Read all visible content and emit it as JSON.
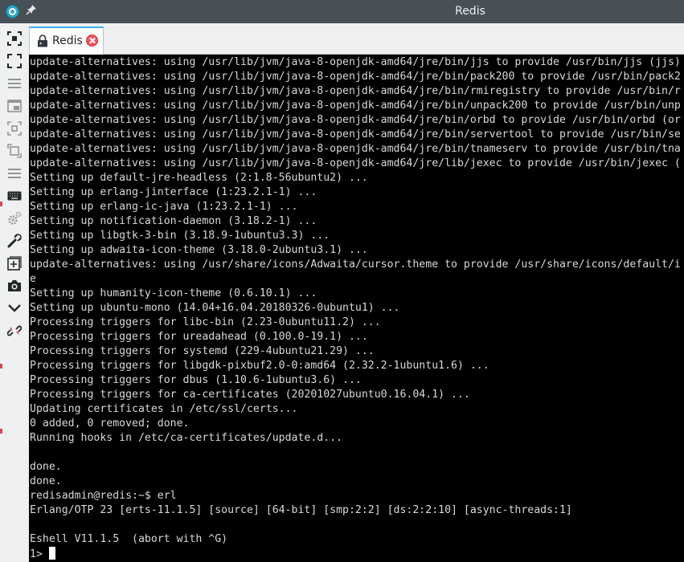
{
  "window": {
    "title": "Redis"
  },
  "titlebar": {
    "app_icon": "app-icon",
    "pin_icon": "pin-icon"
  },
  "toolbar": {
    "items": [
      {
        "name": "screenshot-select-icon",
        "enabled": true
      },
      {
        "name": "fullscreen-icon",
        "enabled": true
      },
      {
        "name": "menu-lines-icon",
        "enabled": false
      },
      {
        "name": "window-icon",
        "enabled": false
      },
      {
        "name": "fit-screen-icon",
        "enabled": false
      },
      {
        "name": "resize-icon",
        "enabled": false
      },
      {
        "name": "list-icon",
        "enabled": false
      },
      {
        "name": "keyboard-icon",
        "enabled": true
      },
      {
        "name": "settings-icon",
        "enabled": false
      },
      {
        "name": "wrench-icon",
        "enabled": true
      },
      {
        "name": "new-window-icon",
        "enabled": true
      },
      {
        "name": "camera-icon",
        "enabled": true
      },
      {
        "name": "chevron-down-icon",
        "enabled": true
      },
      {
        "name": "disconnect-icon",
        "enabled": true
      }
    ]
  },
  "tabs": [
    {
      "label": "Redis",
      "icon": "terminal-lock-icon",
      "close_icon": "close-icon",
      "active": true
    }
  ],
  "terminal": {
    "lines": [
      "update-alternatives: using /usr/lib/jvm/java-8-openjdk-amd64/jre/bin/jjs to provide /usr/bin/jjs (jjs)",
      "update-alternatives: using /usr/lib/jvm/java-8-openjdk-amd64/jre/bin/pack200 to provide /usr/bin/pack2",
      "update-alternatives: using /usr/lib/jvm/java-8-openjdk-amd64/jre/bin/rmiregistry to provide /usr/bin/r",
      "update-alternatives: using /usr/lib/jvm/java-8-openjdk-amd64/jre/bin/unpack200 to provide /usr/bin/unp",
      "update-alternatives: using /usr/lib/jvm/java-8-openjdk-amd64/jre/bin/orbd to provide /usr/bin/orbd (or",
      "update-alternatives: using /usr/lib/jvm/java-8-openjdk-amd64/jre/bin/servertool to provide /usr/bin/se",
      "update-alternatives: using /usr/lib/jvm/java-8-openjdk-amd64/jre/bin/tnameserv to provide /usr/bin/tna",
      "update-alternatives: using /usr/lib/jvm/java-8-openjdk-amd64/jre/lib/jexec to provide /usr/bin/jexec (",
      "Setting up default-jre-headless (2:1.8-56ubuntu2) ...",
      "Setting up erlang-jinterface (1:23.2.1-1) ...",
      "Setting up erlang-ic-java (1:23.2.1-1) ...",
      "Setting up notification-daemon (3.18.2-1) ...",
      "Setting up libgtk-3-bin (3.18.9-1ubuntu3.3) ...",
      "Setting up adwaita-icon-theme (3.18.0-2ubuntu3.1) ...",
      "update-alternatives: using /usr/share/icons/Adwaita/cursor.theme to provide /usr/share/icons/default/i",
      "e",
      "Setting up humanity-icon-theme (0.6.10.1) ...",
      "Setting up ubuntu-mono (14.04+16.04.20180326-0ubuntu1) ...",
      "Processing triggers for libc-bin (2.23-0ubuntu11.2) ...",
      "Processing triggers for ureadahead (0.100.0-19.1) ...",
      "Processing triggers for systemd (229-4ubuntu21.29) ...",
      "Processing triggers for libgdk-pixbuf2.0-0:amd64 (2.32.2-1ubuntu1.6) ...",
      "Processing triggers for dbus (1.10.6-1ubuntu3.6) ...",
      "Processing triggers for ca-certificates (20201027ubuntu0.16.04.1) ...",
      "Updating certificates in /etc/ssl/certs...",
      "0 added, 0 removed; done.",
      "Running hooks in /etc/ca-certificates/update.d...",
      "",
      "done.",
      "done.",
      "redisadmin@redis:~$ erl",
      "Erlang/OTP 23 [erts-11.1.5] [source] [64-bit] [smp:2:2] [ds:2:2:10] [async-threads:1]",
      "",
      "Eshell V11.1.5  (abort with ^G)"
    ],
    "prompt": "1> ",
    "cursor_icon": "block-cursor"
  },
  "colors": {
    "titlebar_bg": "#475057",
    "toolbar_bg": "#eff0f1",
    "terminal_bg": "#000000",
    "terminal_fg": "#d8d8d8",
    "accent": "#3daee9",
    "close_red": "#ed5565"
  }
}
